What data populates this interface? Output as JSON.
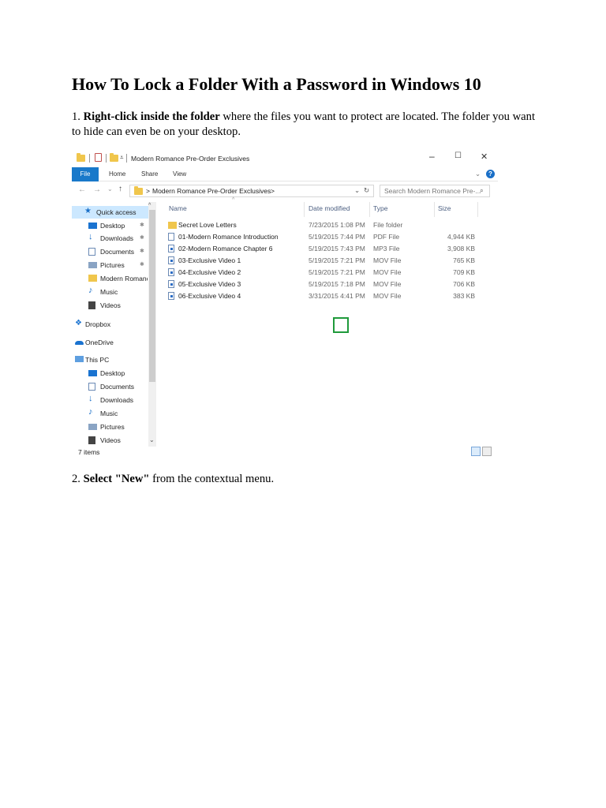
{
  "doc": {
    "title": "How To Lock a Folder With a Password in Windows 10",
    "step1": {
      "number": "1.",
      "bold": "Right-click inside the folder",
      "rest": " where the files you want to protect are located. The folder you want to hide can even be on your desktop."
    },
    "step2": {
      "number": "2.",
      "bold": "Select \"New\"",
      "rest": " from the contextual menu."
    }
  },
  "explorer": {
    "window_title": "Modern Romance Pre-Order Exclusives",
    "controls": {
      "minimize": "–",
      "maximize": "☐",
      "close": "✕"
    },
    "ribbon": {
      "file": "File",
      "home": "Home",
      "share": "Share",
      "view": "View",
      "help": "?"
    },
    "address": {
      "path": "Modern Romance Pre-Order Exclusives",
      "chevron": ">"
    },
    "search_placeholder": "Search Modern Romance Pre-...",
    "columns": {
      "name": "Name",
      "date": "Date modified",
      "type": "Type",
      "size": "Size"
    },
    "nav": [
      {
        "label": "Quick access",
        "icon": "star-icon"
      },
      {
        "label": "Desktop",
        "icon": "desktop-icon"
      },
      {
        "label": "Downloads",
        "icon": "download-icon"
      },
      {
        "label": "Documents",
        "icon": "documents-icon"
      },
      {
        "label": "Pictures",
        "icon": "pictures-icon"
      },
      {
        "label": "Modern Romance",
        "icon": "folder-icon"
      },
      {
        "label": "Music",
        "icon": "music-icon"
      },
      {
        "label": "Videos",
        "icon": "videos-icon"
      },
      {
        "label": "Dropbox",
        "icon": "dropbox-icon"
      },
      {
        "label": "OneDrive",
        "icon": "onedrive-icon"
      },
      {
        "label": "This PC",
        "icon": "pc-icon"
      },
      {
        "label": "Desktop",
        "icon": "desktop-icon"
      },
      {
        "label": "Documents",
        "icon": "documents-icon"
      },
      {
        "label": "Downloads",
        "icon": "download-icon"
      },
      {
        "label": "Music",
        "icon": "music-icon"
      },
      {
        "label": "Pictures",
        "icon": "pictures-icon"
      },
      {
        "label": "Videos",
        "icon": "videos-icon"
      }
    ],
    "files": [
      {
        "name": "Secret Love Letters",
        "date": "7/23/2015 1:08 PM",
        "type": "File folder",
        "size": ""
      },
      {
        "name": "01-Modern Romance Introduction",
        "date": "5/19/2015 7:44 PM",
        "type": "PDF File",
        "size": "4,944 KB"
      },
      {
        "name": "02-Modern Romance Chapter 6",
        "date": "5/19/2015 7:43 PM",
        "type": "MP3 File",
        "size": "3,908 KB"
      },
      {
        "name": "03-Exclusive Video 1",
        "date": "5/19/2015 7:21 PM",
        "type": "MOV File",
        "size": "765 KB"
      },
      {
        "name": "04-Exclusive Video 2",
        "date": "5/19/2015 7:21 PM",
        "type": "MOV File",
        "size": "709 KB"
      },
      {
        "name": "05-Exclusive Video 3",
        "date": "5/19/2015 7:18 PM",
        "type": "MOV File",
        "size": "706 KB"
      },
      {
        "name": "06-Exclusive Video 4",
        "date": "3/31/2015 4:41 PM",
        "type": "MOV File",
        "size": "383 KB"
      }
    ],
    "status": "7 items",
    "colors": {
      "accent": "#1979ca",
      "selection": "#cce8ff",
      "highlight_box": "#1f9a3b"
    }
  }
}
